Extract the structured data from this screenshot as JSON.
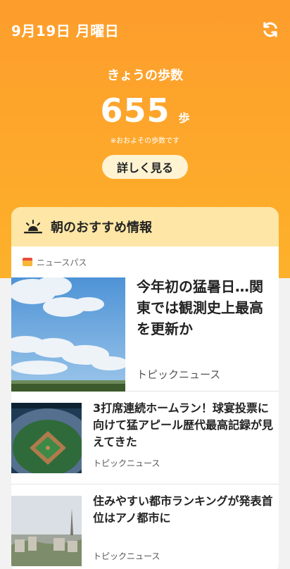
{
  "header": {
    "date": "9月19日 月曜日",
    "refresh_icon": "refresh-icon"
  },
  "steps": {
    "title": "きょうの歩数",
    "value": "655",
    "unit": "歩",
    "note": "※おおよその歩数です",
    "detail_button": "詳しく見る"
  },
  "recommend": {
    "title": "朝のおすすめ情報",
    "header_icon": "sunrise-icon",
    "source": "ニュースパス",
    "articles": [
      {
        "title": "今年初の猛暑日…関東では観測史上最高を更新か",
        "category": "トピックニュース",
        "image": "sky-clouds"
      },
      {
        "title": "3打席連続ホームラン！球宴投票に向けて猛アピール歴代最高記録が見えてきた",
        "category": "トピックニュース",
        "image": "baseball-stadium"
      },
      {
        "title": "住みやすい都市ランキングが発表首位はアノ都市に",
        "category": "トピックニュース",
        "image": "city-skyline"
      }
    ]
  },
  "colors": {
    "accent": "#fd9d2c",
    "card_header": "#fde6a6",
    "button_bg": "#fff3d2"
  }
}
